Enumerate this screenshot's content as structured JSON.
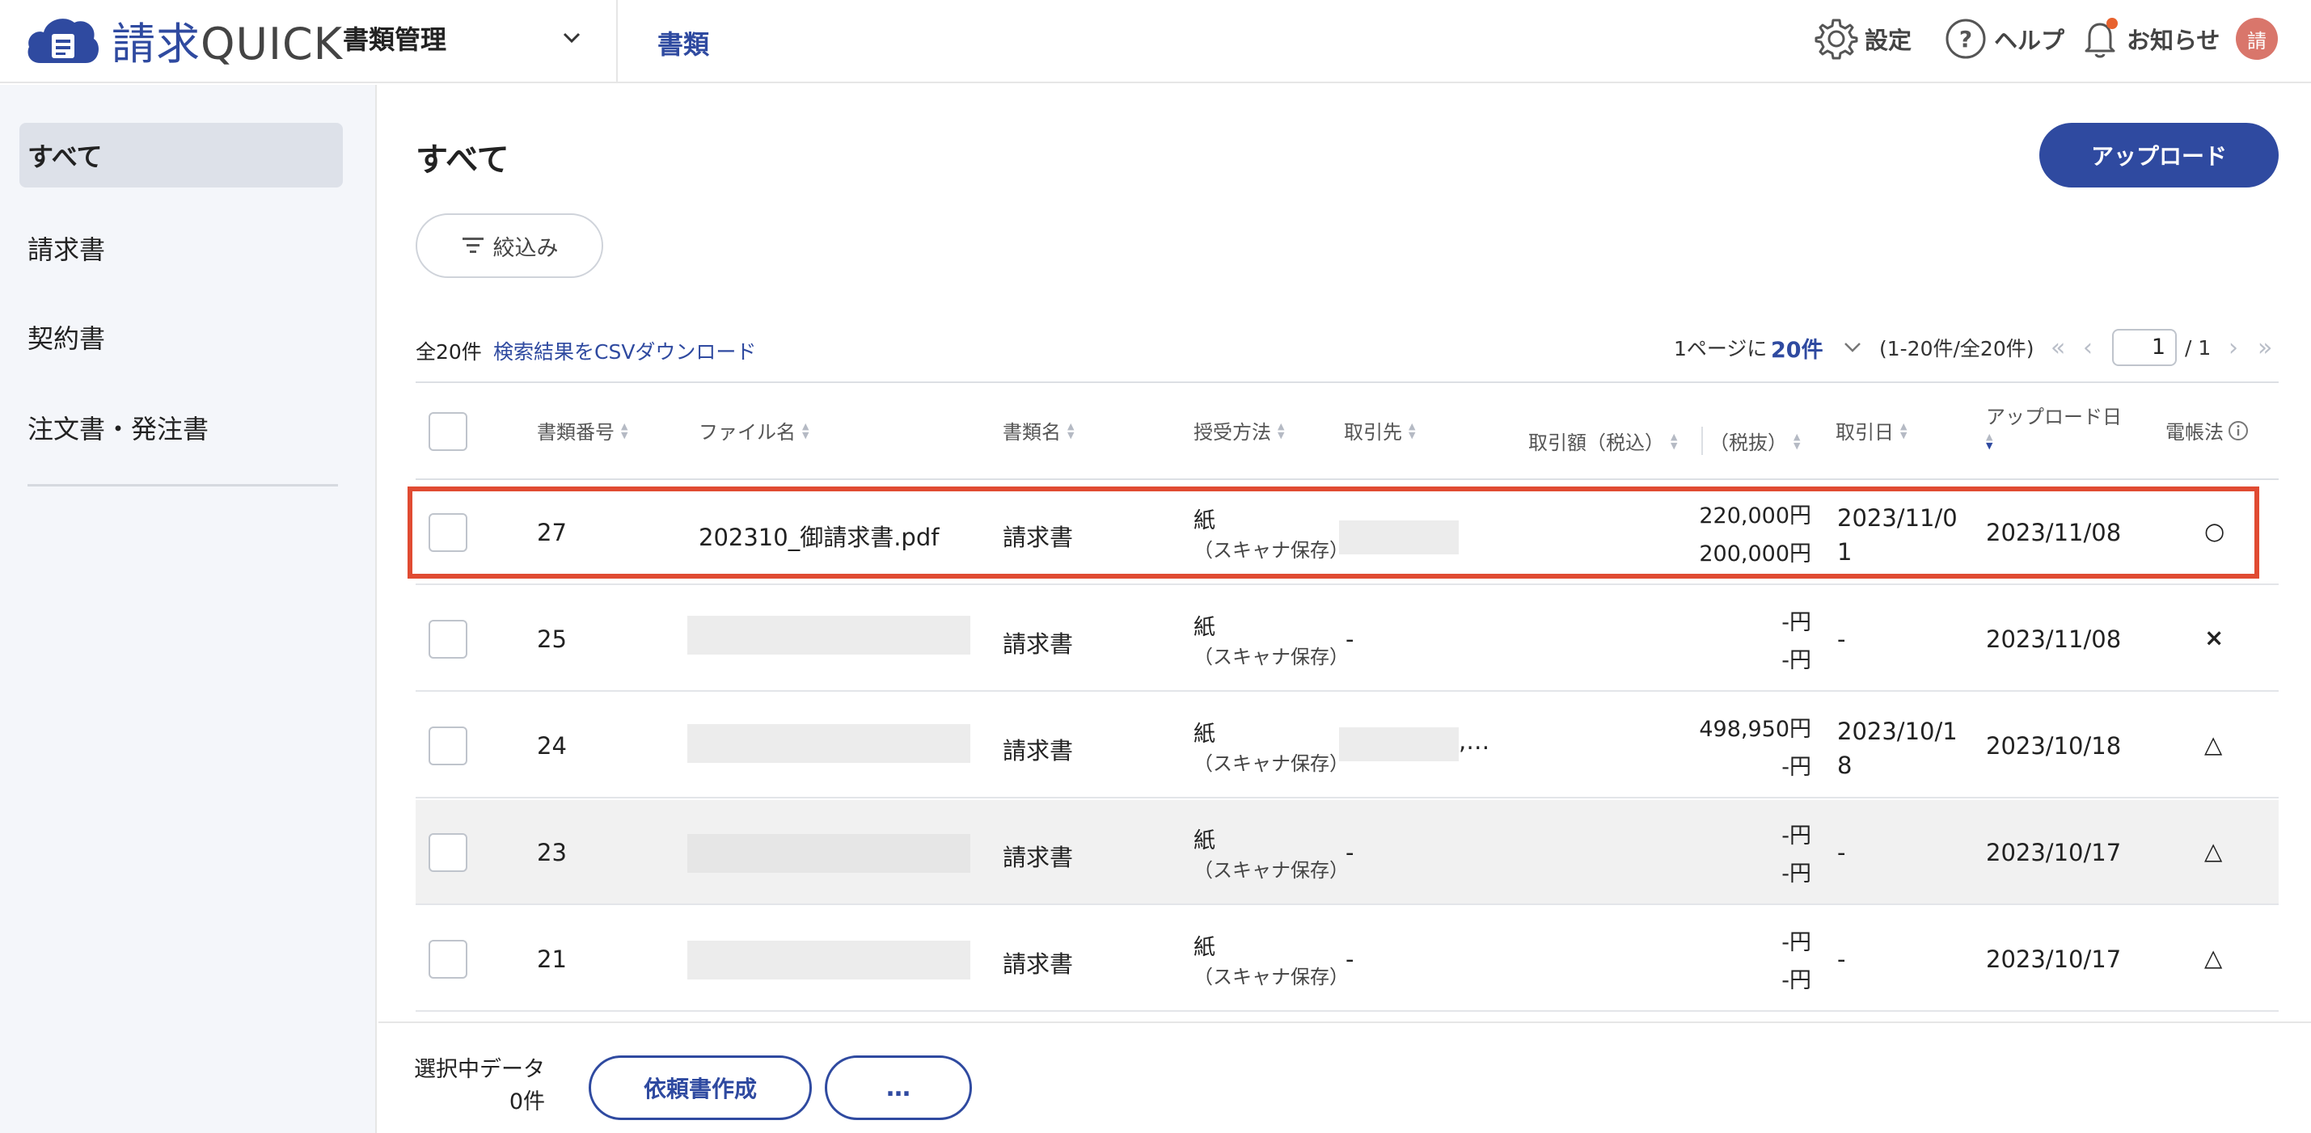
{
  "header": {
    "logo_text": "請求",
    "logo_text_q": "QUICK",
    "module_label": "書類管理",
    "nav_docs": "書類",
    "settings_label": "設定",
    "help_label": "ヘルプ",
    "notice_label": "お知らせ",
    "avatar_initial": "請"
  },
  "sidebar": {
    "items": [
      {
        "label": "すべて",
        "active": true
      },
      {
        "label": "請求書"
      },
      {
        "label": "契約書"
      },
      {
        "label": "注文書・発注書"
      }
    ]
  },
  "main": {
    "title": "すべて",
    "upload_label": "アップロード",
    "filter_label": "絞込み",
    "total_count": "全20件",
    "csv_link": "検索結果をCSVダウンロード",
    "per_page_label": "1ページに",
    "per_page_value": "20件",
    "range_text": "(1-20件/全20件)",
    "page_first": "«",
    "page_prev": "‹",
    "current_page": "1",
    "page_total": "/ 1",
    "page_next": "›",
    "page_last": "»"
  },
  "table": {
    "columns": {
      "doc_no": "書類番号",
      "file_name": "ファイル名",
      "doc_type": "書類名",
      "method": "授受方法",
      "partner": "取引先",
      "amount_incl": "取引額（税込）",
      "amount_excl": "（税抜）",
      "trade_date": "取引日",
      "upload_date": "アップロード日",
      "ebook": "電帳法"
    },
    "rows": [
      {
        "no": "27",
        "file": "202310_御請求書.pdf",
        "type": "請求書",
        "method1": "紙",
        "method2": "（スキャナ保存）",
        "partner": "",
        "amt1": "220,000円",
        "amt2": "200,000円",
        "trade1": "2023/11/0",
        "trade2": "1",
        "upload": "2023/11/08",
        "ebook": "○"
      },
      {
        "no": "25",
        "file": "",
        "type": "請求書",
        "method1": "紙",
        "method2": "（スキャナ保存）",
        "partner": "-",
        "amt1": "-円",
        "amt2": "-円",
        "trade1": "-",
        "trade2": "",
        "upload": "2023/11/08",
        "ebook": "×"
      },
      {
        "no": "24",
        "file": "",
        "type": "請求書",
        "method1": "紙",
        "method2": "（スキャナ保存）",
        "partner": ",…",
        "amt1": "498,950円",
        "amt2": "-円",
        "trade1": "2023/10/1",
        "trade2": "8",
        "upload": "2023/10/18",
        "ebook": "△"
      },
      {
        "no": "23",
        "file": "",
        "type": "請求書",
        "method1": "紙",
        "method2": "（スキャナ保存）",
        "partner": "-",
        "amt1": "-円",
        "amt2": "-円",
        "trade1": "-",
        "trade2": "",
        "upload": "2023/10/17",
        "ebook": "△"
      },
      {
        "no": "21",
        "file": "",
        "type": "請求書",
        "method1": "紙",
        "method2": "（スキャナ保存）",
        "partner": "-",
        "amt1": "-円",
        "amt2": "-円",
        "trade1": "-",
        "trade2": "",
        "upload": "2023/10/17",
        "ebook": "△"
      }
    ]
  },
  "footer": {
    "selected_label": "選択中データ",
    "selected_count": "0件",
    "create_request_label": "依頼書作成",
    "more_label": "…"
  },
  "colors": {
    "brand": "#2f4aa0",
    "highlight": "#e04b32",
    "notification_dot": "#e8622e"
  }
}
